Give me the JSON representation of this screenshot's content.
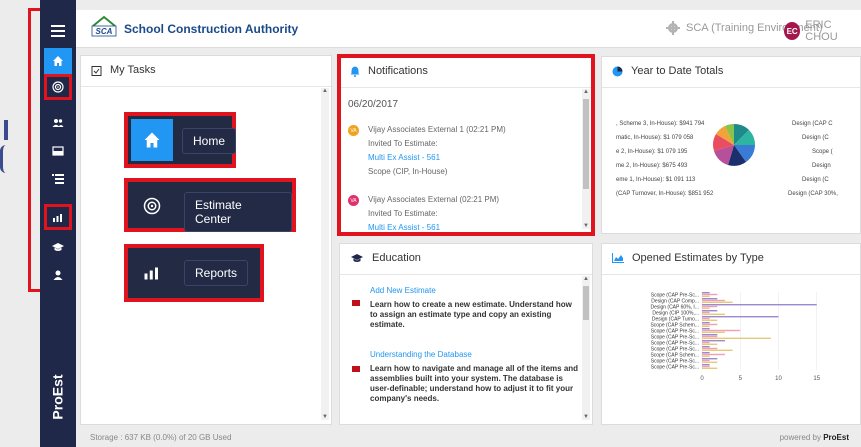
{
  "header": {
    "org_name": "School Construction Authority",
    "logo_text": "SCA",
    "environment": "SCA (Training Environment)",
    "user_initials": "EC",
    "user_name": "ERIC CHOU"
  },
  "sidebar": {
    "items": [
      {
        "icon": "menu-icon"
      },
      {
        "icon": "home-icon"
      },
      {
        "icon": "estimate-center-icon"
      },
      {
        "icon": "users-icon"
      },
      {
        "icon": "inbox-icon"
      },
      {
        "icon": "list-icon"
      },
      {
        "icon": "reports-icon"
      },
      {
        "icon": "education-icon"
      },
      {
        "icon": "support-icon"
      }
    ],
    "brand": "ProEst"
  },
  "my_tasks": {
    "title": "My Tasks",
    "callouts": [
      {
        "label": "Home"
      },
      {
        "label": "Estimate Center"
      },
      {
        "label": "Reports"
      }
    ]
  },
  "notifications": {
    "title": "Notifications",
    "date": "06/20/2017",
    "items": [
      {
        "initials": "VA",
        "line1": "Vijay Associates External 1 (02:21 PM)",
        "line2": "Invited To Estimate:",
        "link": "Multi Ex Assist - 561",
        "line3": "Scope (CIP, In-House)",
        "color": "#f0a31e"
      },
      {
        "initials": "VA",
        "line1": "Vijay Associates External (02:21 PM)",
        "line2": "Invited To Estimate:",
        "link": "Multi Ex Assist - 561",
        "color": "#e0306e"
      }
    ]
  },
  "ytd": {
    "title": "Year to Date Totals",
    "left_labels": [
      ", Scheme 3, In-House): $941 794",
      "matic, In-House): $1 079 058",
      "e 2, In-House): $1 079 195",
      "me 2, In-House): $675 493",
      "eme 1, In-House): $1 091 113",
      "(CAP Turnover, In-House): $851 952"
    ],
    "right_labels": [
      "Design (CAP C",
      "Design (C",
      "Scope (",
      "Design",
      "Design (C",
      "Design (CAP 30%,"
    ]
  },
  "education": {
    "title": "Education",
    "items": [
      {
        "link": "Add New Estimate",
        "desc": "Learn how to create a new estimate. Understand how to assign an estimate type and copy an existing estimate."
      },
      {
        "link": "Understanding the Database",
        "desc": "Learn how to navigate and manage all of the items and assemblies built into your system. The database is user-definable; understand how to adjust it to fit your company's needs."
      }
    ]
  },
  "opened": {
    "title": "Opened Estimates by Type"
  },
  "chart_data": {
    "type": "bar",
    "orientation": "horizontal",
    "categories": [
      "Scope (CAP Pre-Sc...",
      "Design (CAP Comp...",
      "Design (CAP 60%, I...",
      "Design (CIP 100%,...",
      "Design (CAP Turno...",
      "Scope (CAP Schem...",
      "Scope (CAP Pre-Sc...",
      "Scope (CAP Pre-Sc...",
      "Scope (CAP Pre-Sc...",
      "Scope (CAP Pre-Sc...",
      "Scope (CAP Schem...",
      "Scope (CAP Pre-Sc...",
      "Scope (CAP Pre-Sc..."
    ],
    "series": [
      {
        "values": [
          1,
          2,
          15,
          2,
          10,
          1,
          1,
          2,
          3,
          1,
          1,
          2,
          1
        ],
        "color": "#9b8ad0"
      },
      {
        "values": [
          2,
          3,
          2,
          1,
          1,
          2,
          5,
          2,
          1,
          2,
          3,
          1,
          1
        ],
        "color": "#f0a0b0"
      },
      {
        "values": [
          1,
          4,
          1,
          3,
          2,
          1,
          3,
          9,
          2,
          4,
          1,
          2,
          2
        ],
        "color": "#e8c87a"
      }
    ],
    "xticks": [
      "0",
      "5",
      "10",
      "15"
    ],
    "xlim": [
      0,
      17
    ]
  },
  "footer": {
    "storage": "Storage : 637 KB (0.0%) of 20 GB Used",
    "powered_by": "powered by",
    "brand": "ProEst"
  }
}
